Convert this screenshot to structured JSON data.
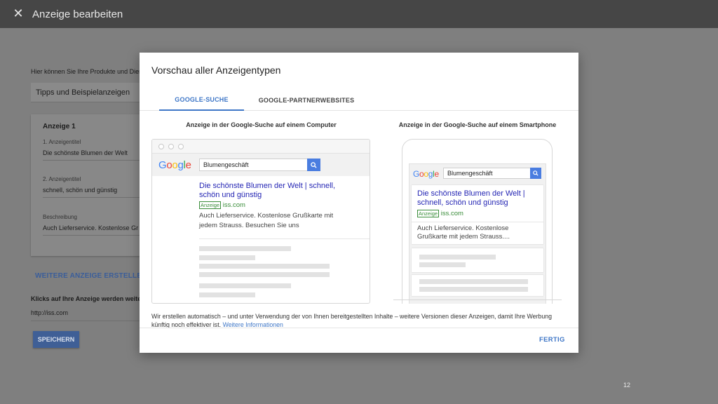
{
  "topbar": {
    "close_icon": "close-icon",
    "title": "Anzeige bearbeiten"
  },
  "background": {
    "intro": "Hier können Sie Ihre Produkte und Dienstleistungen sowie die Besonderheiten Ihres Unternehmens hervorheben",
    "tips_select": "Tipps und Beispielanzeigen",
    "card": {
      "heading": "Anzeige 1",
      "fields": [
        {
          "label": "1. Anzeigentitel",
          "value": "Die schönste Blumen der Welt"
        },
        {
          "label": "2. Anzeigentitel",
          "value": "schnell, schön und günstig"
        },
        {
          "label": "Beschreibung",
          "value": "Auch Lieferservice. Kostenlose Gr"
        }
      ]
    },
    "more_ads_link": "WEITERE ANZEIGE ERSTELLEN",
    "clicks_label": "Klicks auf Ihre Anzeige werden weiter",
    "url_value": "http://iss.com",
    "save_button": "SPEICHERN",
    "page_number": "12"
  },
  "dialog": {
    "title": "Vorschau aller Anzeigentypen",
    "tabs": [
      {
        "label": "GOOGLE-SUCHE",
        "active": true
      },
      {
        "label": "GOOGLE-PARTNERWEBSITES",
        "active": false
      }
    ],
    "desktop": {
      "heading": "Anzeige in der Google-Suche auf einem Computer",
      "search_query": "Blumengeschäft",
      "ad_title_line1": "Die schönste Blumen der Welt | schnell,",
      "ad_title_line2": "schön und günstig",
      "ad_badge": "Anzeige",
      "ad_url": "iss.com",
      "ad_desc_line1": "Auch Lieferservice. Kostenlose Grußkarte mit",
      "ad_desc_line2": "jedem Strauss. Besuchen Sie uns"
    },
    "mobile": {
      "heading": "Anzeige in der Google-Suche auf einem Smartphone",
      "search_query": "Blumengeschäft",
      "ad_title_line1": "Die schönste Blumen der Welt |",
      "ad_title_line2": "schnell, schön und günstig",
      "ad_badge": "Anzeige",
      "ad_url": "iss.com",
      "ad_desc_line1": "Auch Lieferservice. Kostenlose",
      "ad_desc_line2": "Grußkarte mit jedem Strauss...."
    },
    "google_logo": "Google",
    "footer_text": "Wir erstellen automatisch – und unter Verwendung der von Ihnen bereitgestellten Inhalte – weitere Versionen dieser Anzeigen, damit Ihre Werbung künftig noch effektiver ist.",
    "footer_link": "Weitere Informationen",
    "done_button": "FERTIG"
  },
  "colors": {
    "accent": "#3f77c7",
    "ad_title": "#2526b4",
    "ad_url": "#3a8d3a",
    "search_button": "#4a7de0"
  }
}
